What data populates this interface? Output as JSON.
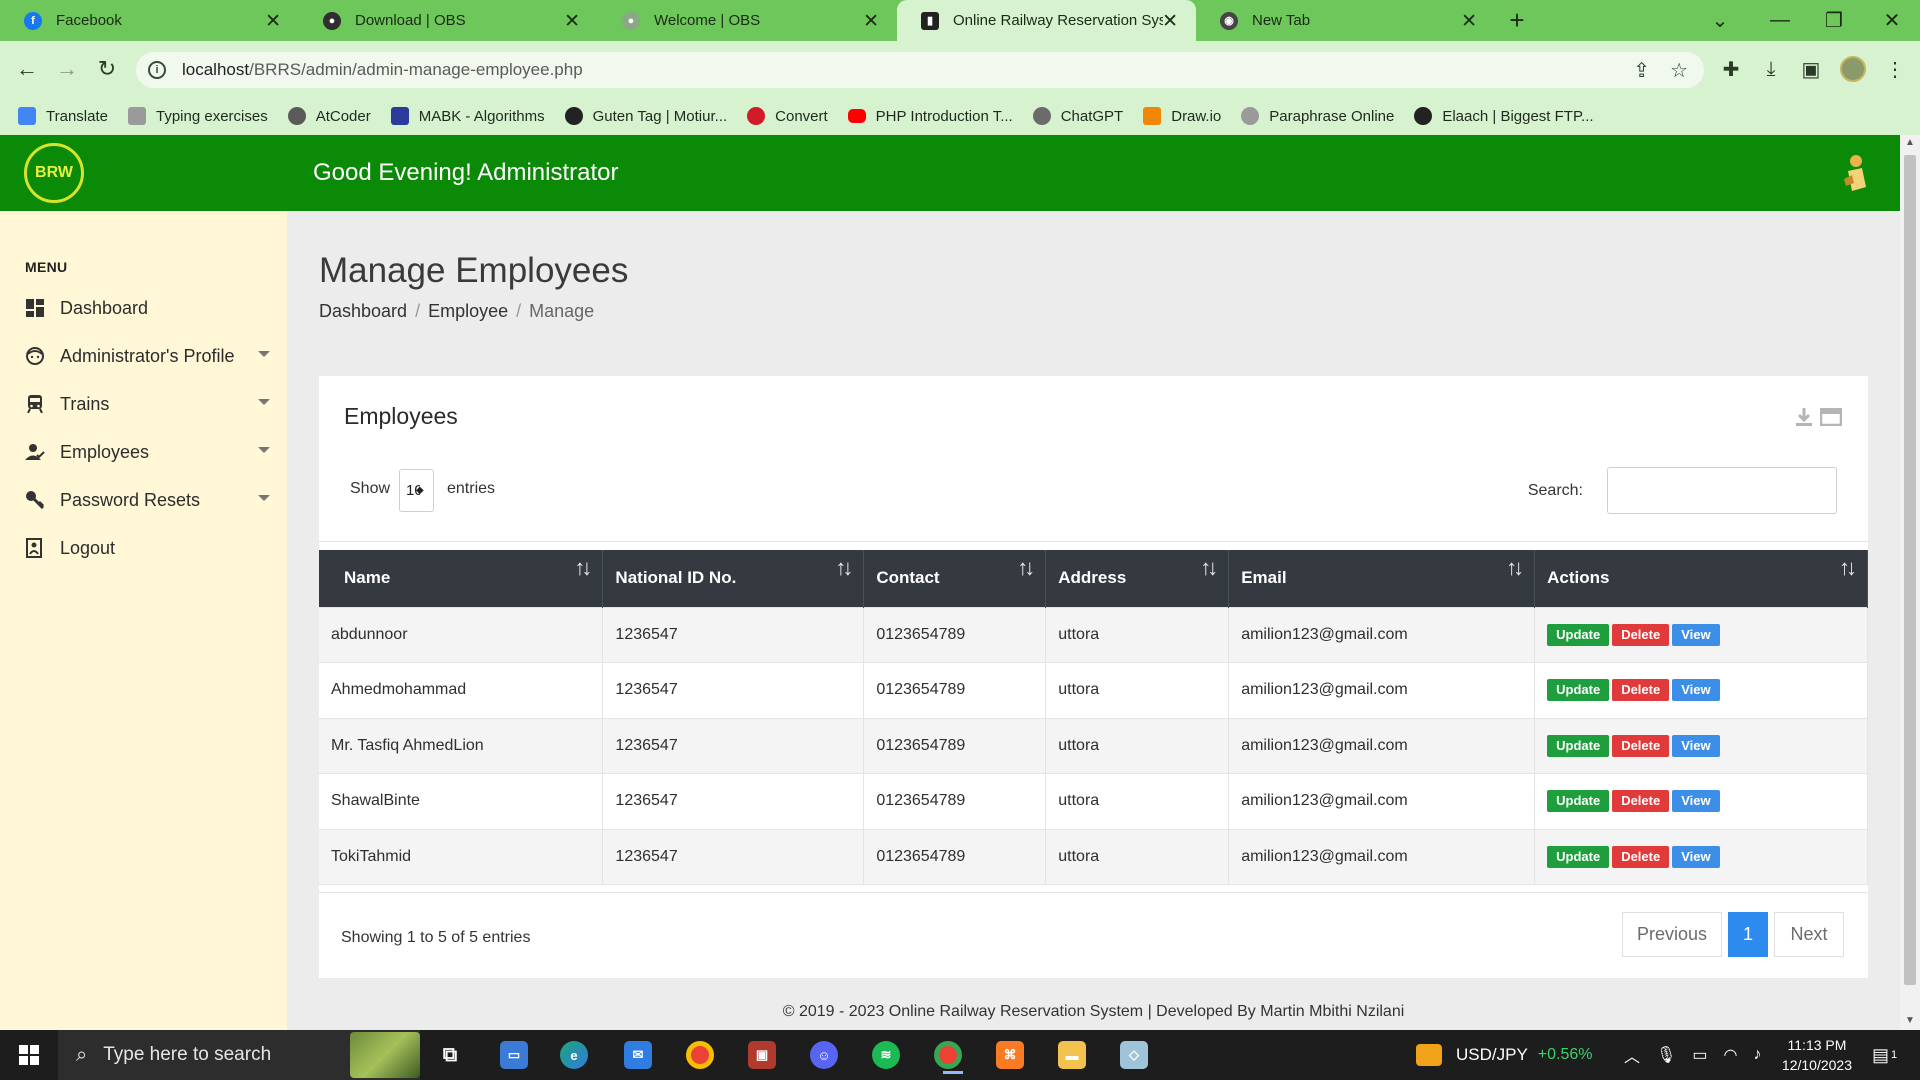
{
  "browser": {
    "tabs": [
      {
        "title": "Facebook",
        "icon": "facebook-icon",
        "color": "#1877f2"
      },
      {
        "title": "Download | OBS",
        "icon": "obs-icon",
        "color": "#302e31"
      },
      {
        "title": "Welcome | OBS",
        "icon": "obs-icon",
        "color": "#8aa884"
      },
      {
        "title": "Online Railway Reservation System",
        "icon": "train-icon",
        "color": "#222222",
        "active": true
      },
      {
        "title": "New Tab",
        "icon": "chrome-icon",
        "color": "#444444"
      }
    ],
    "url_host": "localhost",
    "url_path": "/BRRS/admin/admin-manage-employee.php",
    "bookmarks": [
      {
        "label": "Translate",
        "color": "#4285f4"
      },
      {
        "label": "Typing exercises",
        "color": "#9a9a9a"
      },
      {
        "label": "AtCoder",
        "color": "#5a5a5a"
      },
      {
        "label": "MABK - Algorithms",
        "color": "#2b3b9b"
      },
      {
        "label": "Guten Tag | Motiur...",
        "color": "#222222"
      },
      {
        "label": "Convert",
        "color": "#d11a2a"
      },
      {
        "label": "PHP Introduction T...",
        "color": "#ff0000"
      },
      {
        "label": "ChatGPT",
        "color": "#6b6b6b"
      },
      {
        "label": "Draw.io",
        "color": "#f08705"
      },
      {
        "label": "Paraphrase Online",
        "color": "#9a9a9a"
      },
      {
        "label": "Elaach | Biggest FTP...",
        "color": "#222222"
      }
    ]
  },
  "header": {
    "logo_text": "BRW",
    "greeting": "Good Evening! Administrator"
  },
  "sidebar": {
    "heading": "MENU",
    "items": [
      {
        "label": "Dashboard",
        "icon": "dashboard-icon",
        "has_caret": false
      },
      {
        "label": "Administrator's Profile",
        "icon": "face-icon",
        "has_caret": true
      },
      {
        "label": "Trains",
        "icon": "train-icon",
        "has_caret": true
      },
      {
        "label": "Employees",
        "icon": "user-check-icon",
        "has_caret": true
      },
      {
        "label": "Password Resets",
        "icon": "key-icon",
        "has_caret": true
      },
      {
        "label": "Logout",
        "icon": "logout-icon",
        "has_caret": false
      }
    ]
  },
  "page": {
    "title": "Manage Employees",
    "breadcrumb": [
      "Dashboard",
      "Employee",
      "Manage"
    ]
  },
  "card": {
    "title": "Employees",
    "show_label": "Show",
    "show_value": "10",
    "entries_label": "entries",
    "search_label": "Search:",
    "search_value": "",
    "columns": [
      "Name",
      "National ID No.",
      "Contact",
      "Address",
      "Email",
      "Actions"
    ],
    "rows": [
      {
        "name": "abdunnoor",
        "national_id": "1236547",
        "contact": "0123654789",
        "address": "uttora",
        "email": "amilion123@gmail.com"
      },
      {
        "name": "Ahmedmohammad",
        "national_id": "1236547",
        "contact": "0123654789",
        "address": "uttora",
        "email": "amilion123@gmail.com"
      },
      {
        "name": "Mr. Tasfiq AhmedLion",
        "national_id": "1236547",
        "contact": "0123654789",
        "address": "uttora",
        "email": "amilion123@gmail.com"
      },
      {
        "name": "ShawalBinte",
        "national_id": "1236547",
        "contact": "0123654789",
        "address": "uttora",
        "email": "amilion123@gmail.com"
      },
      {
        "name": "TokiTahmid",
        "national_id": "1236547",
        "contact": "0123654789",
        "address": "uttora",
        "email": "amilion123@gmail.com"
      }
    ],
    "actions": {
      "update": "Update",
      "delete": "Delete",
      "view": "View"
    },
    "info": "Showing 1 to 5 of 5 entries",
    "pagination": {
      "previous": "Previous",
      "current": "1",
      "next": "Next"
    }
  },
  "footer": {
    "text": "© 2019 - 2023 Online Railway Reservation System | Developed By Martin Mbithi Nzilani"
  },
  "taskbar": {
    "search_placeholder": "Type here to search",
    "ticker": "USD/JPY",
    "ticker_change": "+0.56%",
    "time": "11:13 PM",
    "date": "12/10/2023",
    "notification_count": "1"
  },
  "colors": {
    "header_green": "#0a8a06",
    "sidebar_bg": "#fff7d6",
    "table_header": "#343a40",
    "update": "#1e9e3c",
    "delete": "#e03a3a",
    "view": "#3d8ee6",
    "page_active": "#2d8bf0"
  }
}
